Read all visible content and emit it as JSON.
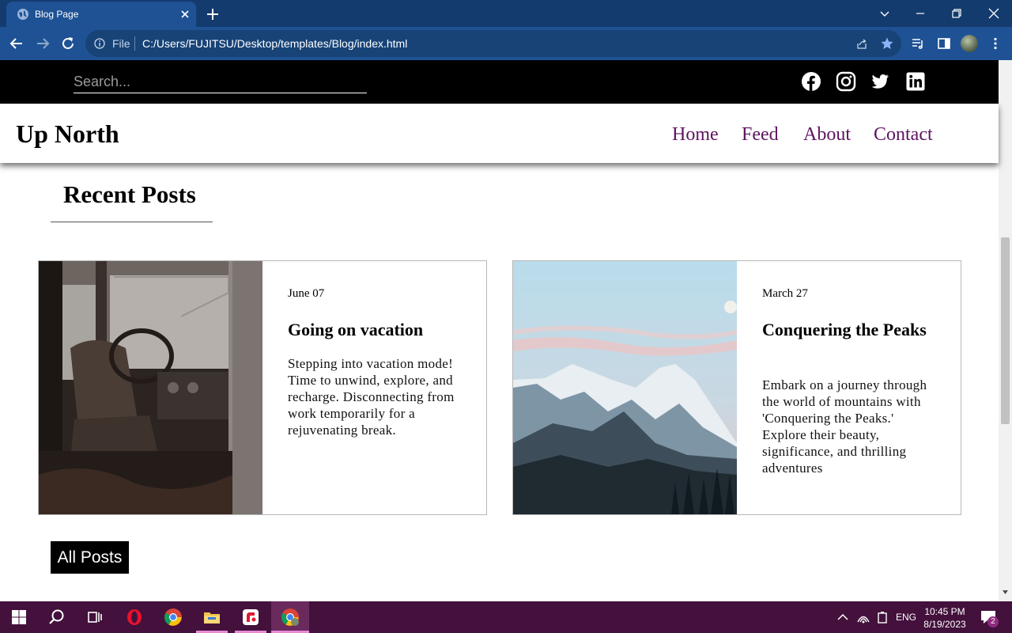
{
  "browser": {
    "tab_title": "Blog Page",
    "omnibox_scheme": "File",
    "url": "C:/Users/FUJITSU/Desktop/templates/Blog/index.html"
  },
  "topbar": {
    "search_placeholder": "Search...",
    "social_icons": [
      "facebook-icon",
      "instagram-icon",
      "twitter-icon",
      "linkedin-icon"
    ]
  },
  "header": {
    "logo": "Up North",
    "nav": [
      "Home",
      "Feed",
      "About",
      "Contact"
    ]
  },
  "main": {
    "section_title": "Recent Posts",
    "posts": [
      {
        "date": "June 07",
        "title": "Going on vacation",
        "description": "Stepping into vacation mode! Time to unwind, explore, and recharge. Disconnecting from work temporarily for a rejuvenating break."
      },
      {
        "date": "March 27",
        "title": "Conquering the Peaks",
        "description": "Embark on a journey through the world of mountains with 'Conquering the Peaks.' Explore their beauty, significance, and thrilling adventures"
      }
    ],
    "all_posts_label": "All Posts"
  },
  "taskbar": {
    "language": "ENG",
    "time": "10:45 PM",
    "date": "8/19/2023",
    "notifications": "2"
  },
  "colors": {
    "tab_bar": "#133b6e",
    "toolbar": "#1e5294",
    "nav_link": "#5d1460",
    "taskbar": "#43113c"
  }
}
